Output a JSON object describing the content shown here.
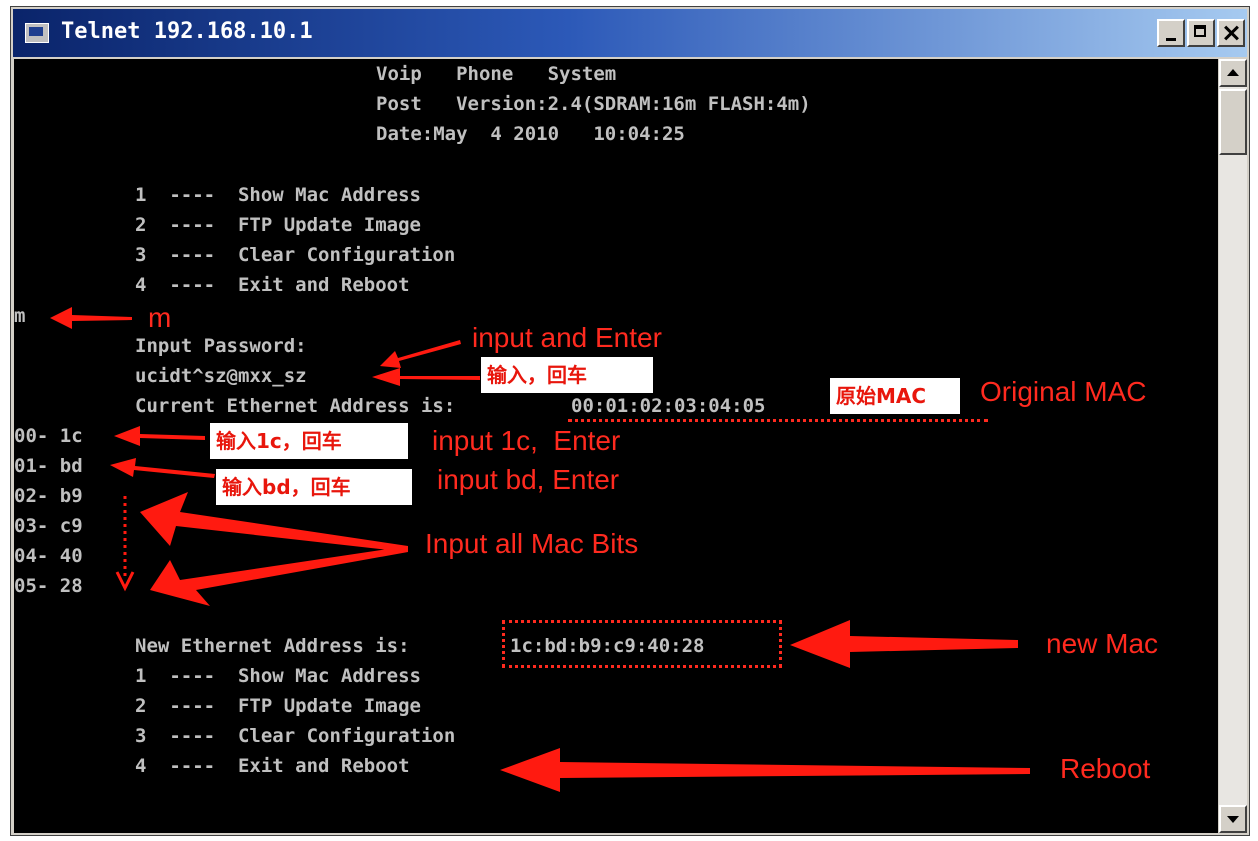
{
  "window": {
    "title": "Telnet 192.168.10.1"
  },
  "terminal": {
    "header": [
      "Voip   Phone   System",
      "Post   Version:2.4(SDRAM:16m FLASH:4m)",
      "Date:May  4 2010   10:04:25"
    ],
    "menu_first": [
      "1  ----  Show Mac Address",
      "2  ----  FTP Update Image",
      "3  ----  Clear Configuration",
      "4  ----  Exit and Reboot"
    ],
    "typed_m": "m",
    "password_prompt": "Input Password:",
    "password_value": "ucidt^sz@mxx_sz",
    "current_mac_label": "Current Ethernet Address is:",
    "current_mac_value": "00:01:02:03:04:05",
    "mac_bytes": [
      "00- 1c",
      "01- bd",
      "02- b9",
      "03- c9",
      "04- 40",
      "05- 28"
    ],
    "new_mac_label": "New Ethernet Address is:",
    "new_mac_value": "1c:bd:b9:c9:40:28",
    "menu_second": [
      "1  ----  Show Mac Address",
      "2  ----  FTP Update Image",
      "3  ----  Clear Configuration",
      "4  ----  Exit and Reboot"
    ]
  },
  "annotations": {
    "m_label": "m",
    "input_enter": "input and Enter",
    "cn_input_enter": "输入，回车",
    "cn_original_mac": "原始MAC",
    "original_mac": "Original MAC",
    "cn_input_1c": "输入1c，回车",
    "input_1c": "input 1c,  Enter",
    "cn_input_bd": "输入bd，回车",
    "input_bd": "input bd, Enter",
    "input_all": "Input all Mac Bits",
    "new_mac": "new Mac",
    "reboot": "Reboot",
    "annotation_color": "#ff2a1f"
  }
}
